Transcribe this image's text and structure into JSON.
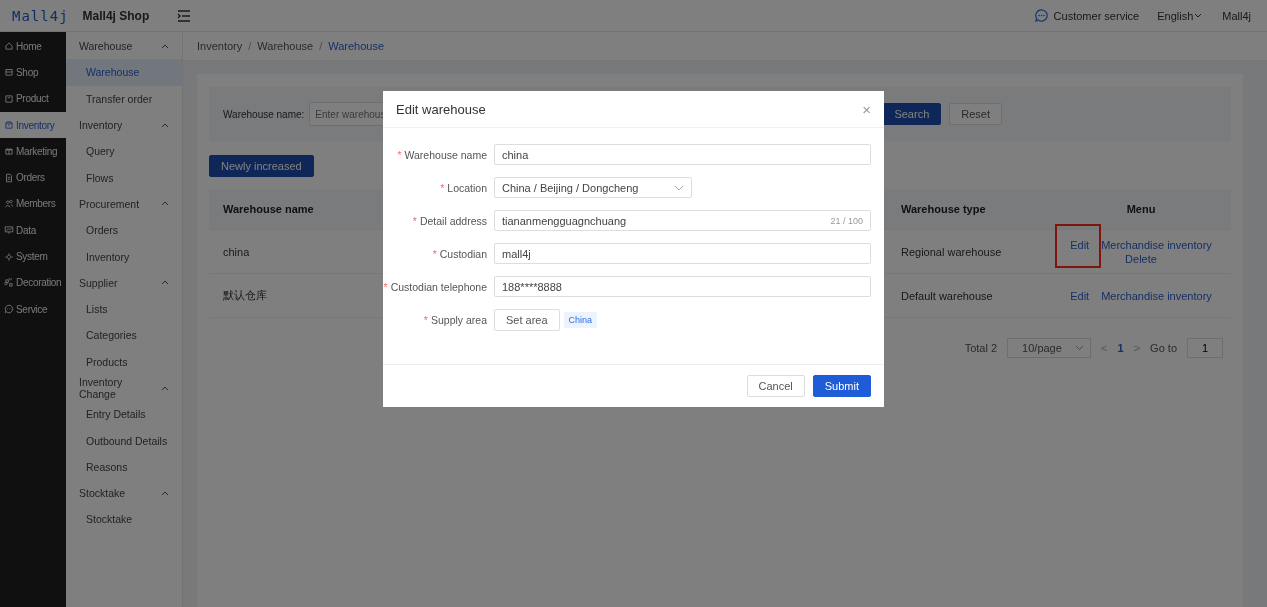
{
  "header": {
    "logo": "Mall4j",
    "shop_name": "Mall4j Shop",
    "customer_service": "Customer service",
    "language": "English",
    "user": "Mall4j"
  },
  "sidebar": {
    "items": [
      {
        "label": "Home",
        "selected": false
      },
      {
        "label": "Shop",
        "selected": false
      },
      {
        "label": "Product",
        "selected": false
      },
      {
        "label": "Inventory",
        "selected": true
      },
      {
        "label": "Marketing",
        "selected": false
      },
      {
        "label": "Orders",
        "selected": false
      },
      {
        "label": "Members",
        "selected": false
      },
      {
        "label": "Data",
        "selected": false
      },
      {
        "label": "System",
        "selected": false
      },
      {
        "label": "Decoration",
        "selected": false
      },
      {
        "label": "Service",
        "selected": false
      }
    ]
  },
  "submenu": {
    "groups": [
      {
        "label": "Warehouse",
        "expanded": true,
        "children": [
          {
            "label": "Warehouse",
            "selected": true
          },
          {
            "label": "Transfer order",
            "selected": false
          }
        ]
      },
      {
        "label": "Inventory",
        "expanded": true,
        "children": [
          {
            "label": "Query",
            "selected": false
          },
          {
            "label": "Flows",
            "selected": false
          }
        ]
      },
      {
        "label": "Procurement",
        "expanded": true,
        "children": [
          {
            "label": "Orders",
            "selected": false
          },
          {
            "label": "Inventory",
            "selected": false
          }
        ]
      },
      {
        "label": "Supplier",
        "expanded": true,
        "children": [
          {
            "label": "Lists",
            "selected": false
          },
          {
            "label": "Categories",
            "selected": false
          },
          {
            "label": "Products",
            "selected": false
          }
        ]
      },
      {
        "label": "Inventory Change",
        "expanded": true,
        "children": [
          {
            "label": "Entry Details",
            "selected": false
          },
          {
            "label": "Outbound Details",
            "selected": false
          },
          {
            "label": "Reasons",
            "selected": false
          }
        ]
      },
      {
        "label": "Stocktake",
        "expanded": true,
        "children": [
          {
            "label": "Stocktake",
            "selected": false
          }
        ]
      }
    ]
  },
  "breadcrumb": {
    "separator": "/",
    "items": [
      "Inventory",
      "Warehouse",
      "Warehouse"
    ]
  },
  "search": {
    "label": "Warehouse name:",
    "placeholder": "Enter warehous",
    "search_button": "Search",
    "reset_button": "Reset"
  },
  "add_button": "Newly increased",
  "table": {
    "columns": [
      {
        "label": "Warehouse name"
      },
      {
        "label": "Warehouse type"
      },
      {
        "label": "Menu"
      }
    ],
    "rows": [
      {
        "name": "china",
        "type": "Regional warehouse",
        "edit_highlighted": true,
        "actions": [
          "Edit",
          "Merchandise inventory",
          "Delete"
        ]
      },
      {
        "name": "默认仓库",
        "type": "Default warehouse",
        "edit_highlighted": false,
        "actions": [
          "Edit",
          "Merchandise inventory"
        ]
      }
    ]
  },
  "pagination": {
    "total": "Total 2",
    "page_size": "10/page",
    "prev": "<",
    "pages": [
      {
        "label": "1",
        "selected": true
      }
    ],
    "next": ">",
    "goto_label": "Go to",
    "goto_value": "1"
  },
  "dialog": {
    "title": "Edit warehouse",
    "close": "×",
    "fields": [
      {
        "kind": "text",
        "label": "Warehouse name",
        "required_mark": "*",
        "value": "china"
      },
      {
        "kind": "select",
        "label": "Location",
        "required_mark": "*",
        "value": "China / Beijing / Dongcheng"
      },
      {
        "kind": "text",
        "label": "Detail address",
        "required_mark": "*",
        "value": "tiananmengguagnchuang",
        "counter": "21 / 100"
      },
      {
        "kind": "text",
        "label": "Custodian",
        "required_mark": "*",
        "value": "mall4j"
      },
      {
        "kind": "text",
        "label": "Custodian telephone",
        "required_mark": "*",
        "value": "188****8888"
      },
      {
        "kind": "area",
        "label": "Supply area",
        "required_mark": "*",
        "button": "Set area",
        "tags": [
          "China"
        ]
      }
    ],
    "cancel": "Cancel",
    "submit": "Submit"
  }
}
